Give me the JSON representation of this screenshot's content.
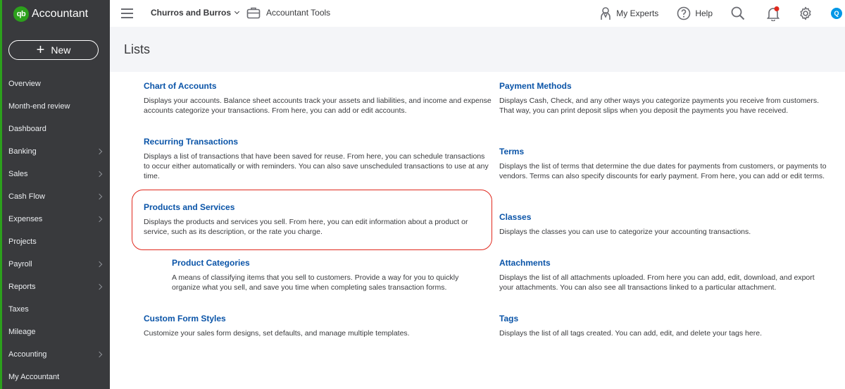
{
  "brand": {
    "logo": "qb",
    "name": "Accountant"
  },
  "new_button": {
    "label": "New",
    "icon": "plus-icon"
  },
  "nav": [
    {
      "label": "Overview",
      "chevron": false
    },
    {
      "label": "Month-end review",
      "chevron": false
    },
    {
      "label": "Dashboard",
      "chevron": false
    },
    {
      "label": "Banking",
      "chevron": true
    },
    {
      "label": "Sales",
      "chevron": true
    },
    {
      "label": "Cash Flow",
      "chevron": true
    },
    {
      "label": "Expenses",
      "chevron": true
    },
    {
      "label": "Projects",
      "chevron": false
    },
    {
      "label": "Payroll",
      "chevron": true
    },
    {
      "label": "Reports",
      "chevron": true
    },
    {
      "label": "Taxes",
      "chevron": false
    },
    {
      "label": "Mileage",
      "chevron": false
    },
    {
      "label": "Accounting",
      "chevron": true
    },
    {
      "label": "My Accountant",
      "chevron": false
    }
  ],
  "topbar": {
    "company": "Churros and Burros",
    "tools": "Accountant Tools",
    "my_experts": "My Experts",
    "help": "Help",
    "avatar": "Q"
  },
  "page": {
    "title": "Lists"
  },
  "lists_left": [
    {
      "title": "Chart of Accounts",
      "desc": "Displays your accounts. Balance sheet accounts track your assets and liabilities, and income and expense accounts categorize your transactions. From here, you can add or edit accounts."
    },
    {
      "title": "Recurring Transactions",
      "desc": "Displays a list of transactions that have been saved for reuse. From here, you can schedule transactions to occur either automatically or with reminders. You can also save unscheduled transactions to use at any time."
    },
    {
      "title": "Products and Services",
      "desc": "Displays the products and services you sell. From here, you can edit information about a product or service, such as its description, or the rate you charge."
    },
    {
      "title": "Product Categories",
      "desc": "A means of classifying items that you sell to customers. Provide a way for you to quickly organize what you sell, and save you time when completing sales transaction forms."
    },
    {
      "title": "Custom Form Styles",
      "desc": "Customize your sales form designs, set defaults, and manage multiple templates."
    }
  ],
  "lists_right": [
    {
      "title": "Payment Methods",
      "desc": "Displays Cash, Check, and any other ways you categorize payments you receive from customers. That way, you can print deposit slips when you deposit the payments you have received."
    },
    {
      "title": "Terms",
      "desc": "Displays the list of terms that determine the due dates for payments from customers, or payments to vendors. Terms can also specify discounts for early payment. From here, you can add or edit terms."
    },
    {
      "title": "Classes",
      "desc": "Displays the classes you can use to categorize your accounting transactions."
    },
    {
      "title": "Attachments",
      "desc": "Displays the list of all attachments uploaded. From here you can add, edit, download, and export your attachments. You can also see all transactions linked to a particular attachment."
    },
    {
      "title": "Tags",
      "desc": "Displays the list of all tags created. You can add, edit, and delete your tags here."
    }
  ],
  "colors": {
    "brand_green": "#2ca01c",
    "sidebar": "#393a3d",
    "link": "#0a54a8",
    "highlight": "#e0281d",
    "header_bg": "#f4f5f8"
  }
}
